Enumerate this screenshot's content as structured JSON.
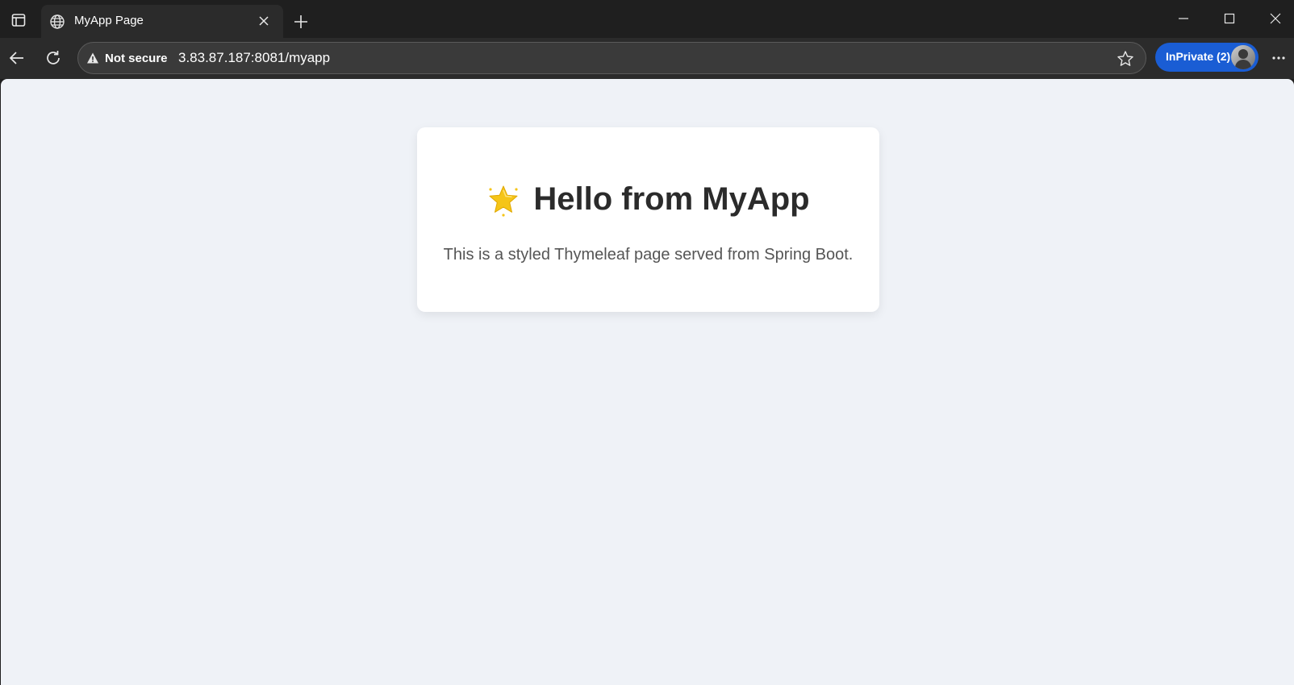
{
  "browser": {
    "tab": {
      "title": "MyApp Page",
      "favicon": "globe-icon"
    },
    "address_bar": {
      "security_label": "Not secure",
      "url": "3.83.87.187:8081/myapp"
    },
    "profile": {
      "label": "InPrivate (2)"
    },
    "colors": {
      "inprivate_accent": "#1a5dd4"
    }
  },
  "page": {
    "heading_icon": "star-icon",
    "heading": "Hello from MyApp",
    "subtitle": "This is a styled Thymeleaf page served from Spring Boot.",
    "background": "#eff2f7"
  }
}
